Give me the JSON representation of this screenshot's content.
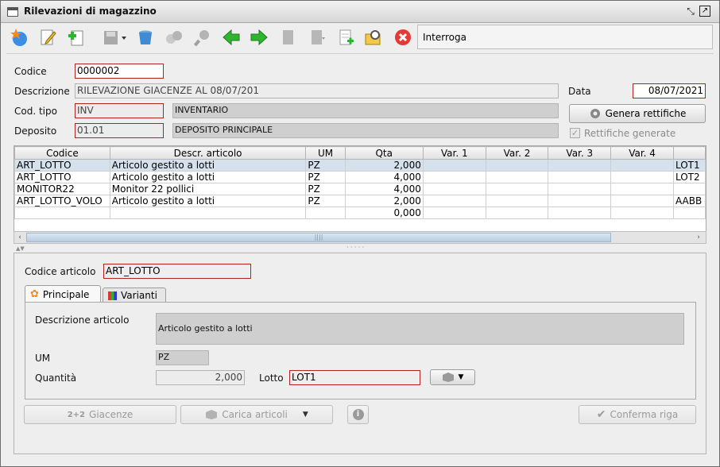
{
  "window": {
    "title": "Rilevazioni di magazzino"
  },
  "toolbar": {
    "mode_text": "Interroga"
  },
  "header": {
    "codice_label": "Codice",
    "codice_value": "0000002",
    "descrizione_label": "Descrizione",
    "descrizione_value": "RILEVAZIONE GIACENZE AL 08/07/201",
    "data_label": "Data",
    "data_value": "08/07/2021",
    "cod_tipo_label": "Cod. tipo",
    "cod_tipo_value": "INV",
    "cod_tipo_desc": "INVENTARIO",
    "deposito_label": "Deposito",
    "deposito_value": "01.01",
    "deposito_desc": "DEPOSITO PRINCIPALE",
    "genera_button": "Genera rettifiche",
    "rettifiche_label": "Rettifiche generate"
  },
  "grid": {
    "columns": [
      "Codice",
      "Descr. articolo",
      "UM",
      "Qta",
      "Var. 1",
      "Var. 2",
      "Var. 3",
      "Var. 4",
      ""
    ],
    "rows": [
      [
        "ART_LOTTO",
        "Articolo gestito a lotti",
        "PZ",
        "2,000",
        "",
        "",
        "",
        "",
        "LOT1"
      ],
      [
        "ART_LOTTO",
        "Articolo gestito a lotti",
        "PZ",
        "4,000",
        "",
        "",
        "",
        "",
        "LOT2"
      ],
      [
        "MONITOR22",
        "Monitor 22 pollici",
        "PZ",
        "4,000",
        "",
        "",
        "",
        "",
        ""
      ],
      [
        "ART_LOTTO_VOLO",
        "Articolo gestito a lotti",
        "PZ",
        "2,000",
        "",
        "",
        "",
        "",
        "AABB"
      ],
      [
        "",
        "",
        "",
        "0,000",
        "",
        "",
        "",
        "",
        ""
      ]
    ],
    "selected_row": 0
  },
  "detail": {
    "codice_articolo_label": "Codice articolo",
    "codice_articolo_value": "ART_LOTTO",
    "tabs": [
      {
        "label": "Principale"
      },
      {
        "label": "Varianti"
      }
    ],
    "descrizione_articolo_label": "Descrizione articolo",
    "descrizione_articolo_value": "Articolo gestito a lotti",
    "um_label": "UM",
    "um_value": "PZ",
    "quantita_label": "Quantità",
    "quantita_value": "2,000",
    "lotto_label": "Lotto",
    "lotto_value": "LOT1",
    "giacenze_prefix": "2+2",
    "giacenze_button": "Giacenze",
    "carica_button": "Carica articoli",
    "conferma_button": "Conferma riga"
  }
}
